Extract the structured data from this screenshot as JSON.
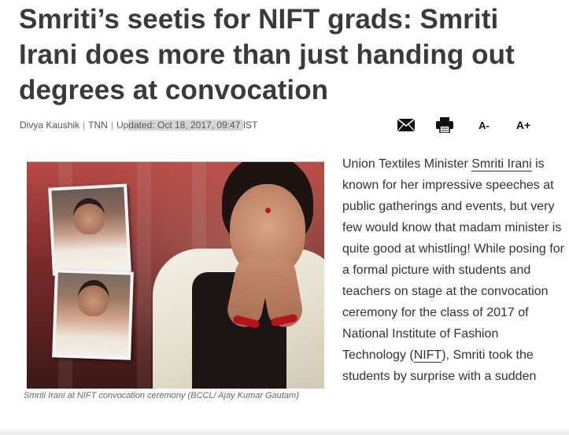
{
  "article": {
    "headline": "Smriti’s seetis for NIFT grads: Smriti Irani does more than just handing out degrees at convocation",
    "byline": {
      "author": "Divya Kaushik",
      "source": "TNN",
      "updated_prefix": "Updated: Oct 18, 2017, 09:47",
      "timezone": "IST",
      "updated_split_a": "Up",
      "updated_split_b": "dated: Oct 18, 2017, 09:47 ",
      "updated_split_c": "IST"
    },
    "tools": {
      "mail_icon": "envelope-icon",
      "print_icon": "printer-icon",
      "decrease_font_label": "A-",
      "increase_font_label": "A+"
    },
    "image": {
      "caption": "Smriti Irani at NIFT convocation ceremony (BCCL/ Ajay Kumar Gautam)"
    },
    "body": {
      "part1": "Union Textiles Minister ",
      "link1": "Smriti Irani",
      "part2": " is known for her impressive speeches at public gatherings and events, but very few would know that madam minister is quite good at whistling! While posing for a formal picture with students and teachers on stage at the convocation ceremony for the class of 2017 of National Institute of Fashion Technology (",
      "link2": "NIFT",
      "part3": "), Smriti took the students by surprise with a sudden"
    }
  }
}
